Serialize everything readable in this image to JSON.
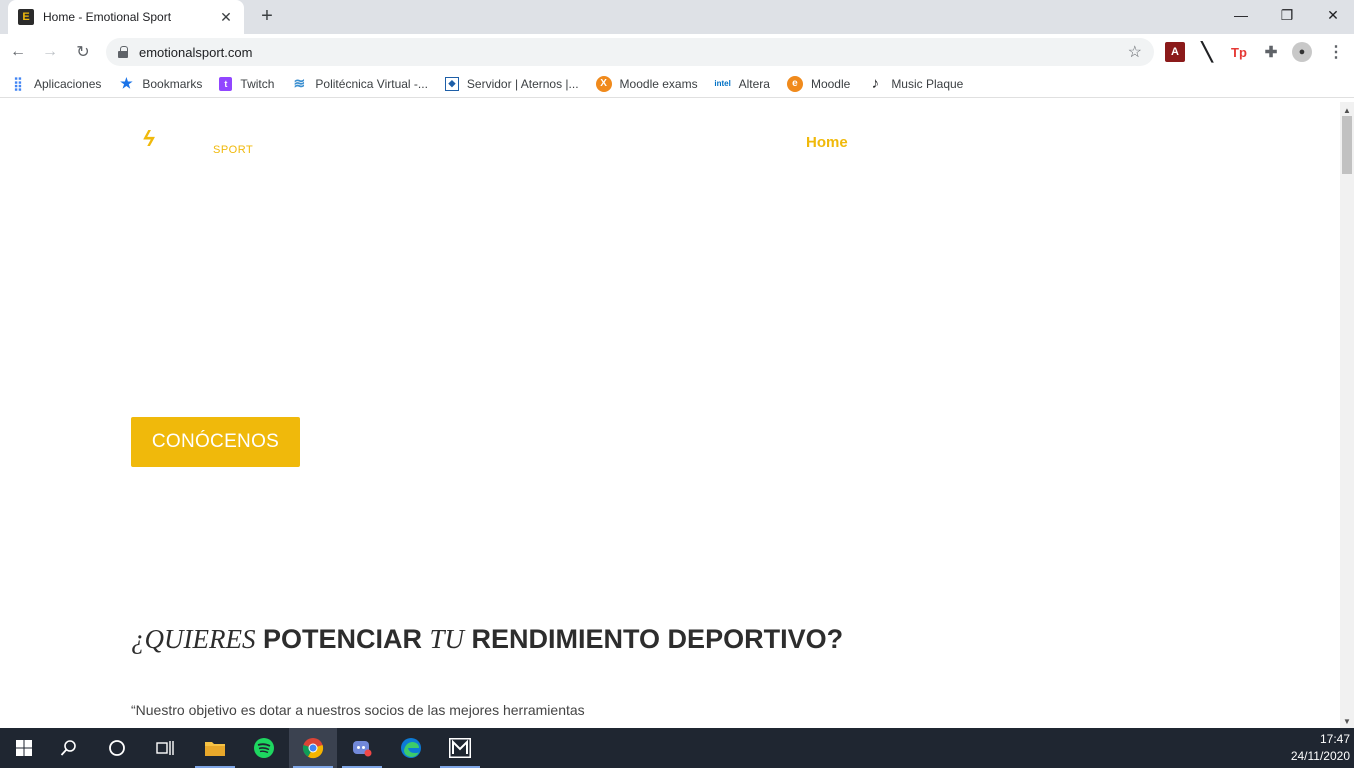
{
  "browser": {
    "tab_title": "Home - Emotional Sport",
    "tab_favicon_letter": "E",
    "url": "emotionalsport.com",
    "bookmarks": [
      {
        "label": "Aplicaciones",
        "icon": "apps-grid-icon"
      },
      {
        "label": "Bookmarks",
        "icon": "star-icon"
      },
      {
        "label": "Twitch",
        "icon": "twitch-icon"
      },
      {
        "label": "Politécnica Virtual -...",
        "icon": "upv-icon"
      },
      {
        "label": "Servidor | Aternos |...",
        "icon": "aternos-icon"
      },
      {
        "label": "Moodle exams",
        "icon": "moodle-exams-icon"
      },
      {
        "label": "Altera",
        "icon": "intel-icon"
      },
      {
        "label": "Moodle",
        "icon": "moodle-icon"
      },
      {
        "label": "Music Plaque",
        "icon": "music-note-icon"
      }
    ],
    "extensions": [
      "acrobat-icon",
      "slash-icon",
      "tp-icon",
      "puzzle-icon",
      "profile-icon",
      "menu-icon"
    ]
  },
  "site": {
    "logo_word": "SPORT",
    "nav_home": "Home",
    "cta_label": "CONÓCENOS",
    "headline": {
      "p1": "¿QUIERES",
      "p2": "POTENCIAR",
      "p3": "TU",
      "p4": "RENDIMIENTO DEPORTIVO?"
    },
    "quote": "“Nuestro objetivo es dotar a nuestros socios de las mejores herramientas"
  },
  "taskbar": {
    "time": "17:47",
    "date": "24/11/2020",
    "apps": [
      "windows-start-icon",
      "search-icon",
      "cortana-icon",
      "task-view-icon",
      "file-explorer-icon",
      "spotify-icon",
      "chrome-icon",
      "discord-icon",
      "edge-icon",
      "m-app-icon"
    ]
  },
  "colors": {
    "brand_yellow": "#f0b90b",
    "taskbar": "#1f2631"
  }
}
